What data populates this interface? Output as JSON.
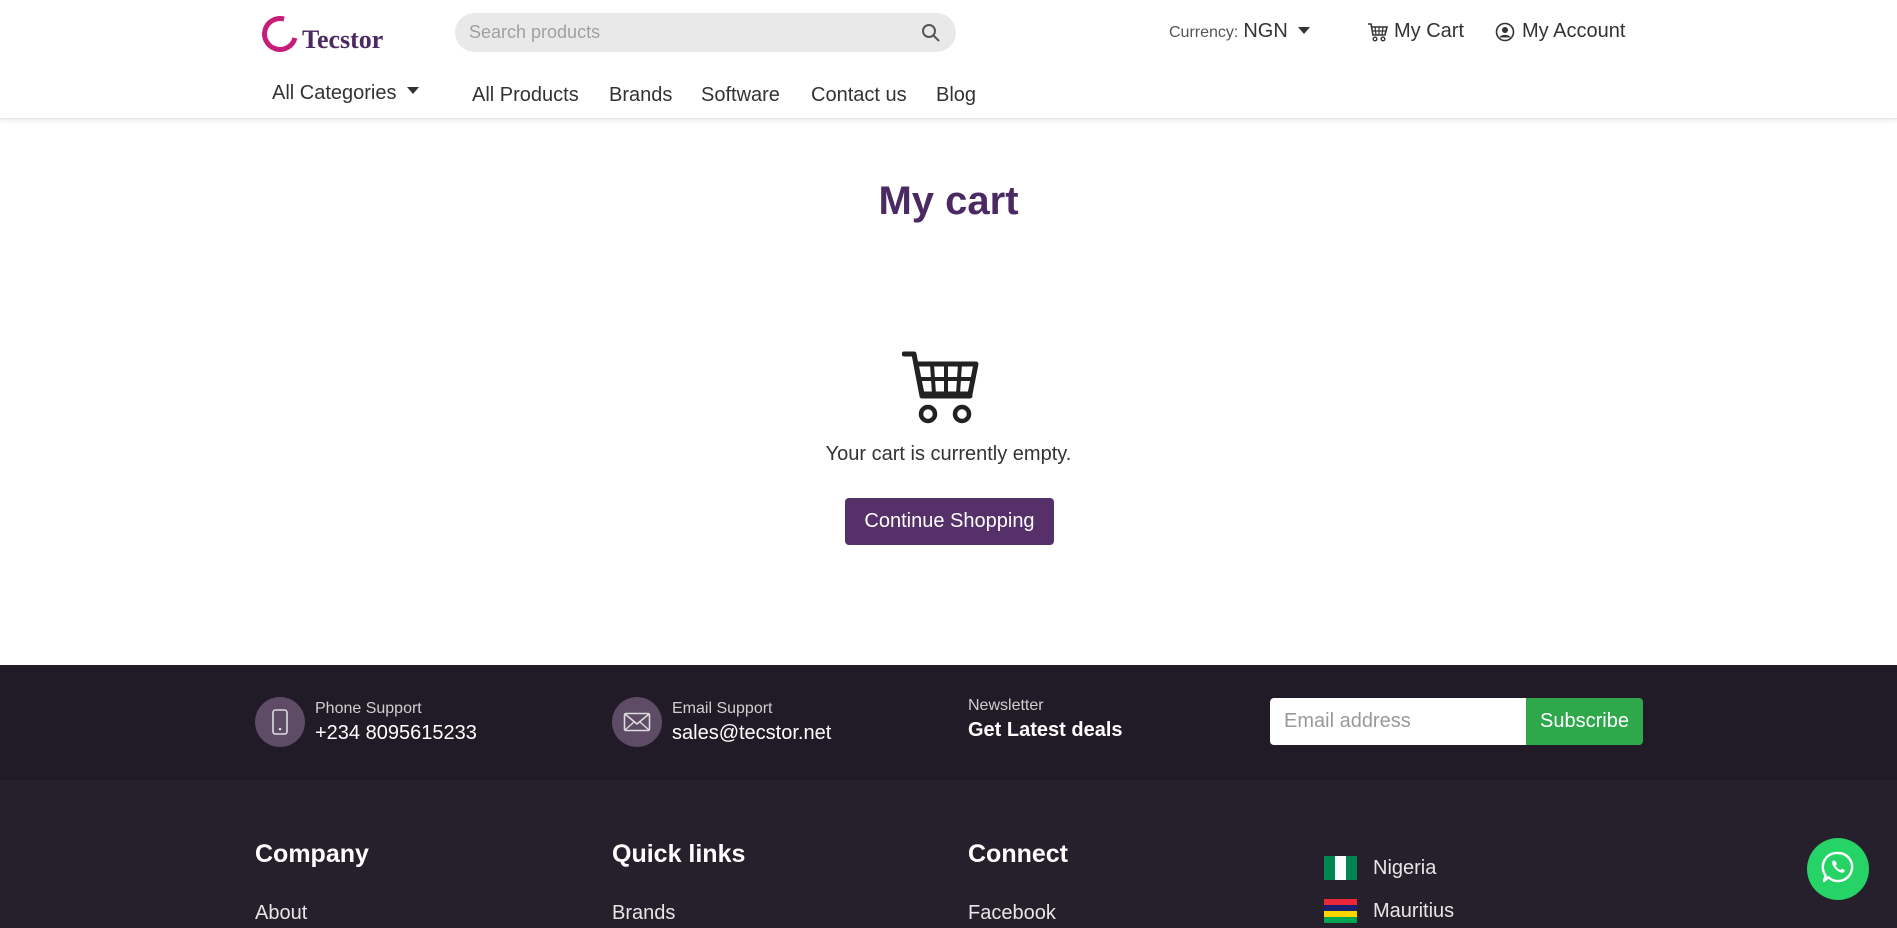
{
  "header": {
    "logo_text": "Tecstor",
    "search_placeholder": "Search products",
    "currency_label": "Currency:",
    "currency_value": "NGN",
    "cart_label": "My Cart",
    "account_label": "My Account"
  },
  "nav": {
    "categories_label": "All Categories",
    "items": [
      "All Products",
      "Brands",
      "Software",
      "Contact us",
      "Blog"
    ]
  },
  "main": {
    "title": "My cart",
    "empty_message": "Your cart is currently empty.",
    "continue_label": "Continue Shopping"
  },
  "footer_bar": {
    "phone_label": "Phone Support",
    "phone_value": "+234 8095615233",
    "email_label": "Email Support",
    "email_value": "sales@tecstor.net",
    "newsletter_label": "Newsletter",
    "newsletter_value": "Get Latest deals",
    "email_placeholder": "Email address",
    "subscribe_label": "Subscribe"
  },
  "footer": {
    "columns": [
      {
        "title": "Company",
        "first_link": "About"
      },
      {
        "title": "Quick links",
        "first_link": "Brands"
      },
      {
        "title": "Connect",
        "first_link": "Facebook"
      }
    ],
    "countries": [
      "Nigeria",
      "Mauritius"
    ]
  },
  "colors": {
    "brand_purple": "#4b2a63",
    "button_purple": "#553069",
    "logo_magenta": "#c51d7a",
    "subscribe_green": "#2ea84a",
    "whatsapp_green": "#25d366",
    "footer_dark": "#211b27"
  },
  "icons": [
    "search-icon",
    "cart-icon",
    "user-circle-icon",
    "phone-icon",
    "envelope-icon",
    "whatsapp-icon"
  ]
}
